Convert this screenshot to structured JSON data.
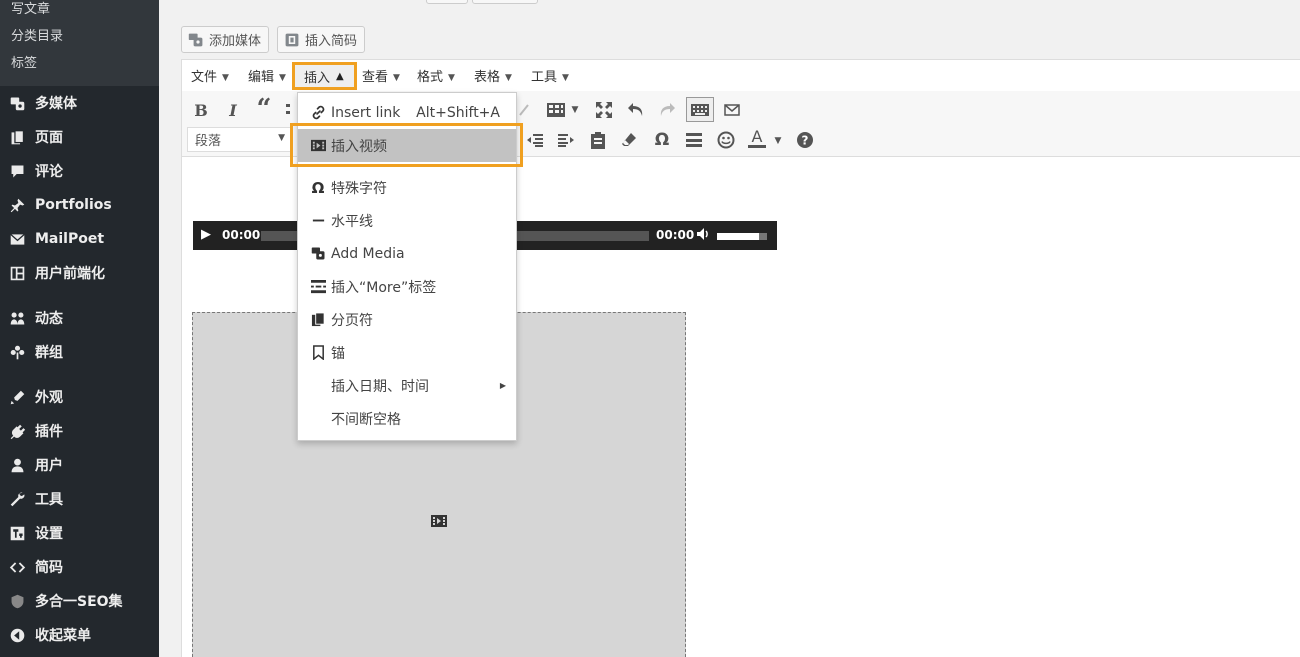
{
  "sidebar": {
    "submenu": [
      "写文章",
      "分类目录",
      "标签"
    ],
    "items": [
      {
        "label": "多媒体",
        "icon": "media-icon"
      },
      {
        "label": "页面",
        "icon": "pages-icon"
      },
      {
        "label": "评论",
        "icon": "comments-icon"
      },
      {
        "label": "Portfolios",
        "icon": "pin-icon"
      },
      {
        "label": "MailPoet",
        "icon": "mail-icon"
      },
      {
        "label": "用户前端化",
        "icon": "layout-icon"
      },
      {
        "label": "动态",
        "icon": "activity-icon"
      },
      {
        "label": "群组",
        "icon": "groups-icon"
      },
      {
        "label": "外观",
        "icon": "appearance-icon"
      },
      {
        "label": "插件",
        "icon": "plugins-icon"
      },
      {
        "label": "用户",
        "icon": "user-icon"
      },
      {
        "label": "工具",
        "icon": "tools-icon"
      },
      {
        "label": "设置",
        "icon": "settings-icon"
      },
      {
        "label": "简码",
        "icon": "code-icon"
      },
      {
        "label": "多合一SEO集",
        "icon": "shield-icon"
      },
      {
        "label": "收起菜单",
        "icon": "collapse-icon"
      }
    ]
  },
  "media_buttons": {
    "add_media": "添加媒体",
    "insert_shortcode": "插入简码"
  },
  "menubar": {
    "file": "文件",
    "edit": "编辑",
    "insert": "插入",
    "view": "查看",
    "format": "格式",
    "table": "表格",
    "tools": "工具"
  },
  "toolbar": {
    "bold": "B",
    "italic": "I",
    "blockquote": "“",
    "special_char": "Ω",
    "text_color": "A",
    "help": "?",
    "format_select": "段落"
  },
  "audio_player": {
    "current_time": "00:00",
    "duration": "00:00"
  },
  "dropdown": {
    "insert_link": "Insert link",
    "insert_link_shortcut": "Alt+Shift+A",
    "insert_video": "插入视频",
    "special_char": "特殊字符",
    "horizontal_line": "水平线",
    "add_media": "Add Media",
    "insert_more": "插入“More”标签",
    "page_break": "分页符",
    "anchor": "锚",
    "insert_datetime": "插入日期、时间",
    "nbsp": "不间断空格"
  },
  "colors": {
    "sidebar_bg": "#23282d",
    "highlight": "#f0a020",
    "selected_item": "#c2c2c2"
  }
}
